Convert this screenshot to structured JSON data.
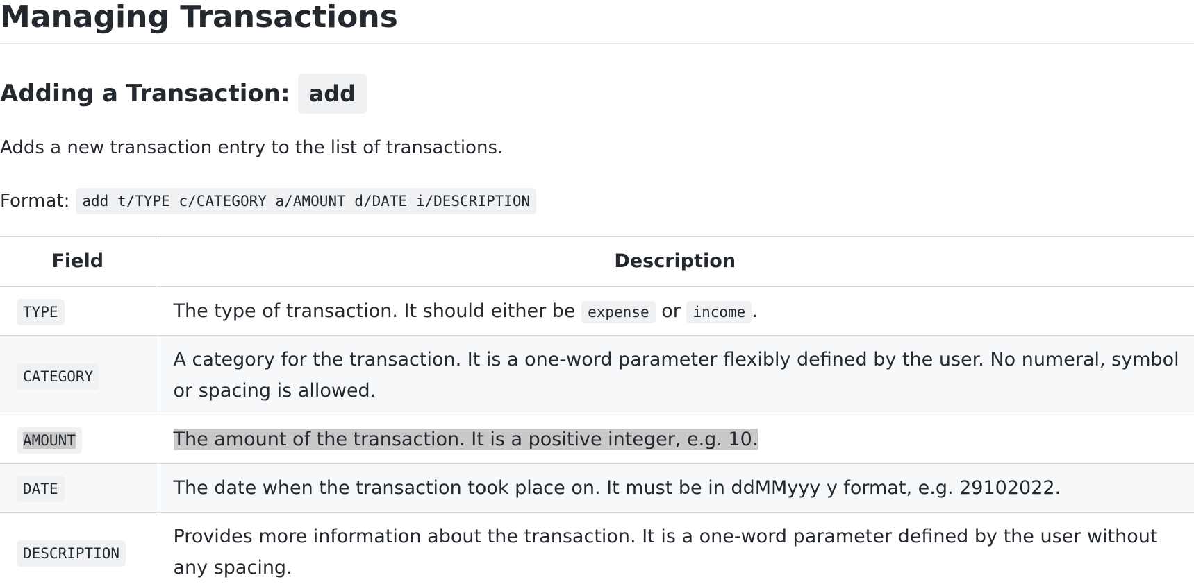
{
  "doc": {
    "title": "Managing Transactions",
    "section": {
      "heading": "Adding a Transaction:",
      "command": "add",
      "description": "Adds a new transaction entry to the list of transactions.",
      "format_label": "Format:",
      "format_code": "add t/TYPE c/CATEGORY a/AMOUNT d/DATE i/DESCRIPTION"
    },
    "table": {
      "headers": [
        "Field",
        "Description"
      ],
      "rows": [
        {
          "field": "TYPE",
          "desc_before": "The type of transaction. It should either be",
          "code1": "expense",
          "desc_mid": "or",
          "code2": "income",
          "desc_after": "."
        },
        {
          "field": "CATEGORY",
          "description": "A category for the transaction. It is a one-word parameter flexibly defined by the user. No numeral, symbol or spacing is allowed."
        },
        {
          "field": "AMOUNT",
          "description": "The amount of the transaction. It is a positive integer, e.g. 10."
        },
        {
          "field": "DATE",
          "description": "The date when the transaction took place on. It must be in ddMMyyy y format, e.g. 29102022."
        },
        {
          "field": "DESCRIPTION",
          "description": "Provides more information about the transaction. It is a one-word parameter defined by the user without any spacing."
        }
      ]
    }
  }
}
